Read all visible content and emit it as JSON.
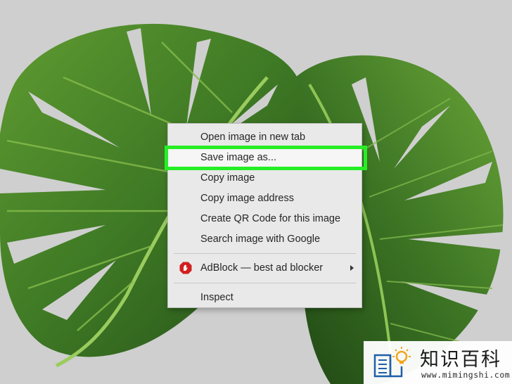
{
  "context_menu": {
    "items": [
      {
        "label": "Open image in new tab"
      },
      {
        "label": "Save image as..."
      },
      {
        "label": "Copy image"
      },
      {
        "label": "Copy image address"
      },
      {
        "label": "Create QR Code for this image"
      },
      {
        "label": "Search image with Google"
      },
      {
        "label": "AdBlock — best ad blocker",
        "icon": "adblock-icon",
        "submenu": true
      },
      {
        "label": "Inspect"
      }
    ],
    "highlighted": "Save image as...",
    "highlight_color": "#26ee26"
  },
  "watermark": {
    "title": "知识百科",
    "url": "www.mimingshi.com"
  },
  "colors": {
    "leaf_dark": "#2a5a1e",
    "leaf_light": "#6ea83a",
    "background": "#cfcfcf",
    "menu_bg": "#e9e9e9",
    "adblock_red": "#d21f1f"
  }
}
